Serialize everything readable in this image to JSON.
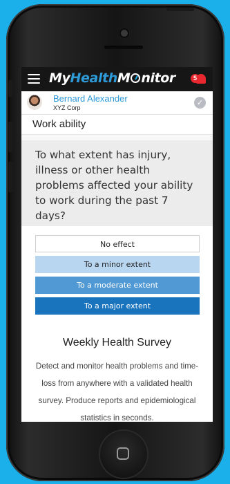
{
  "app": {
    "logo_parts": [
      "My",
      "Health",
      "M",
      "nitor"
    ],
    "notification_count": "5",
    "colors": {
      "brand_blue": "#2e9ad8",
      "background": "#1cb0ea",
      "alert_red": "#e8282e"
    }
  },
  "user": {
    "name": "Bernard Alexander",
    "company": "XYZ Corp"
  },
  "section": {
    "title": "Work ability"
  },
  "question": {
    "text": "To what extent has injury, illness or other health problems affected your ability to work during the past 7 days?"
  },
  "answers": [
    {
      "label": "No effect"
    },
    {
      "label": "To a minor extent"
    },
    {
      "label": "To a moderate extent"
    },
    {
      "label": "To a major extent"
    }
  ],
  "survey": {
    "title": "Weekly Health Survey",
    "description": "Detect and monitor health problems and time-loss from anywhere with a validated health survey. Produce reports and epidemiological statistics in seconds."
  },
  "icons": [
    "menu-icon",
    "gauge-icon",
    "bell-icon",
    "avatar",
    "check-icon",
    "home-icon"
  ]
}
